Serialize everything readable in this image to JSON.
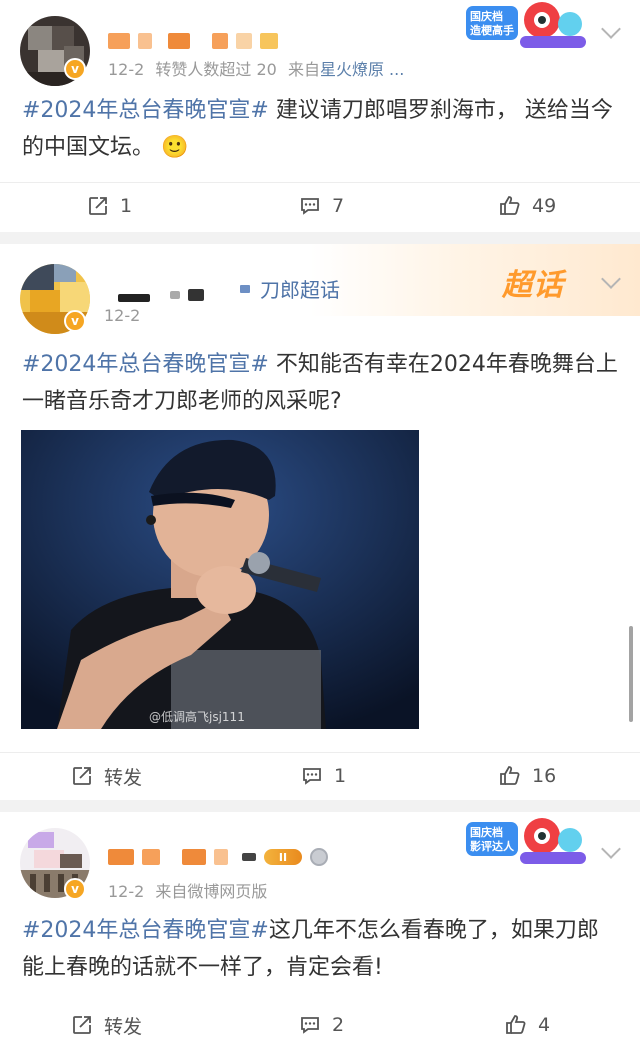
{
  "posts": [
    {
      "meta": {
        "date": "12-2",
        "extra": "转赞人数超过 20",
        "from": "来自",
        "source": "星火燎原 ..."
      },
      "badge": {
        "line1": "国庆档",
        "line2": "造梗高手"
      },
      "content": {
        "topic": "#2024年总台春晚官宣#",
        "text": " 建议请刀郎唱罗刹海市， 送给当今的中国文坛。",
        "emoji": "🙂"
      },
      "actions": {
        "repost": "1",
        "comment": "7",
        "like": "49"
      }
    },
    {
      "meta": {
        "date": "12-2"
      },
      "topic_tag": "刀郎超话",
      "superchat": "超话",
      "content": {
        "topic": "#2024年总台春晚官宣#",
        "text": "  不知能否有幸在2024年春晚舞台上一睹音乐奇才刀郎老师的风采呢?"
      },
      "image": {
        "watermark": "@低调高飞jsj111"
      },
      "actions": {
        "repost": "转发",
        "comment": "1",
        "like": "16"
      }
    },
    {
      "meta": {
        "date": "12-2",
        "from": "来自",
        "source": "微博网页版"
      },
      "badge": {
        "line1": "国庆档",
        "line2": "影评达人"
      },
      "level": "II",
      "content": {
        "topic": "#2024年总台春晚官宣#",
        "text": "这几年不怎么看春晚了，如果刀郎能上春晚的话就不一样了，肯定会看!"
      },
      "actions": {
        "repost": "转发",
        "comment": "2",
        "like": "4"
      }
    }
  ],
  "colors": {
    "topic": "#4f74a8",
    "meta": "#999999",
    "orange": "#f6a623",
    "bg": "#f2f2f2"
  },
  "icons": {
    "repost": "share-box-icon",
    "comment": "comment-bubble-icon",
    "like": "thumbs-up-icon",
    "more": "chevron-down-icon"
  }
}
